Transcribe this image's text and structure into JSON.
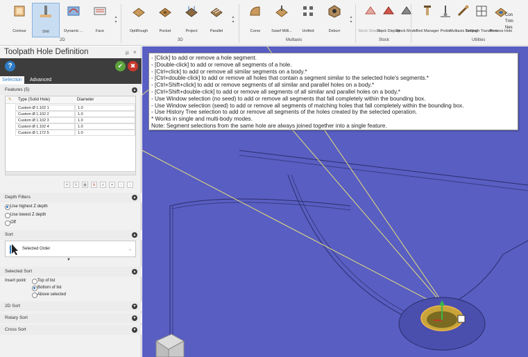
{
  "ribbon": {
    "items": [
      {
        "label": "Contour",
        "icon": "contour-icon"
      },
      {
        "label": "Drill",
        "icon": "drill-icon",
        "active": true
      },
      {
        "label": "Dynamic ...",
        "icon": "dynamic-icon"
      },
      {
        "label": "Face",
        "icon": "face-icon"
      },
      {
        "label": "OptiRough",
        "icon": "optirough-icon"
      },
      {
        "label": "Pocket",
        "icon": "pocket-icon"
      },
      {
        "label": "Project",
        "icon": "project-icon"
      },
      {
        "label": "Parallel",
        "icon": "parallel-icon"
      },
      {
        "label": "Curve",
        "icon": "curve-icon"
      },
      {
        "label": "Swarf Milli...",
        "icon": "swarf-icon"
      },
      {
        "label": "Unified",
        "icon": "unified-icon"
      },
      {
        "label": "Deburr",
        "icon": "deburr-icon"
      },
      {
        "label": "Stock Shading",
        "icon": "stock-shading-icon"
      },
      {
        "label": "Stock Display",
        "icon": "stock-display-icon"
      },
      {
        "label": "Stock Model",
        "icon": "stock-model-icon"
      },
      {
        "label": "Tool Manager",
        "icon": "tool-manager-icon"
      },
      {
        "label": "Probe",
        "icon": "probe-icon"
      },
      {
        "label": "Multiaxis Linking",
        "icon": "multiaxis-linking-icon"
      },
      {
        "label": "Toolpath Transform",
        "icon": "toolpath-transform-icon"
      },
      {
        "label": "Process Hole",
        "icon": "process-hole-icon"
      }
    ],
    "extra": [
      "Con",
      "Trim",
      "Nes"
    ],
    "groups": {
      "g2d": "2D",
      "g3d": "3D",
      "multiaxis": "Multiaxis",
      "stock": "Stock",
      "utilities": "Utilities"
    }
  },
  "panel": {
    "title": "Toolpath Hole Definition",
    "pin": "µ",
    "close": "×",
    "help": "?",
    "tabs": [
      "Selection",
      "Advanced"
    ],
    "features_label": "Features (5)",
    "table": {
      "columns": [
        "Type (Solid Hole)",
        "Diameter"
      ],
      "rows": [
        {
          "type": "Custom Ø 1.102 1",
          "diameter": "1.0"
        },
        {
          "type": "Custom Ø 1.102 2",
          "diameter": "1.0"
        },
        {
          "type": "Custom Ø 1.102 3",
          "diameter": "1.0"
        },
        {
          "type": "Custom Ø 1.102 4",
          "diameter": "1.0"
        },
        {
          "type": "Custom Ø 1.172 5",
          "diameter": "1.0"
        }
      ]
    },
    "depth_filters": {
      "label": "Depth Filters",
      "options": [
        "Use highest Z depth",
        "Use lowest Z depth",
        "Off"
      ],
      "selected": "Use highest Z depth"
    },
    "sort": {
      "label": "Sort",
      "value": "Selected Order"
    },
    "selected_sort": {
      "label": "Selected Sort",
      "insert_label": "Insert point:",
      "options": [
        "Top of list",
        "Bottom of list",
        "Above selected"
      ],
      "selected": "Bottom of list"
    },
    "collapsed_sections": [
      "2D Sort",
      "Rotary Sort",
      "Cross Sort"
    ]
  },
  "tooltip": {
    "lines": [
      "- [Click] to add or remove a hole segment.",
      "- [Double-click] to add or remove all segments of a hole.",
      "- [Ctrl+click] to add or remove all similar segments on a body.*",
      "- [Ctrl+double-click] to add or remove all holes that contain a segment similar to the selected hole's segments.*",
      "- [Ctrl+Shift+click] to add or remove segments of all similar and parallel holes on a body.*",
      "- [Ctrl+Shift+double-click] to add or remove all segments of all similar and parallel holes on a body.*",
      "- Use Window selection (no seed) to add or remove all segments that fall completely within the bounding box.",
      "- Use Window selection (seed) to add or remove all segments of matching holes that fall completely within the bounding box.",
      "- Use History Tree selection to add or remove all segments of the holes created by the selected operation.",
      "* Works in single and multi-body modes.",
      "Note: Segment selections from the same hole are always joined together into a single feature."
    ]
  },
  "colors": {
    "viewport_bg": "#5a5fc0",
    "panel_dark": "#3d3d3d",
    "accent": "#2f7bc4",
    "ok": "#5ba33b",
    "cancel": "#c7392c",
    "highlight_line": "#e6e07a"
  }
}
